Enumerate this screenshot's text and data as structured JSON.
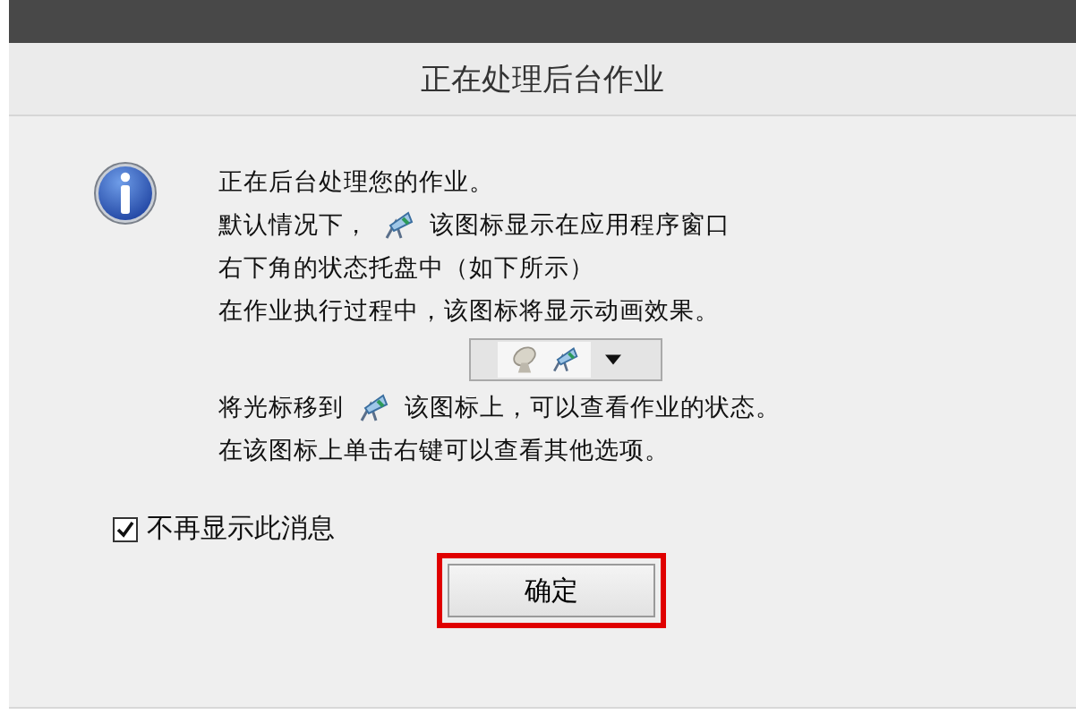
{
  "window": {
    "title": "正在处理后台作业"
  },
  "message": [
    {
      "kind": "text",
      "text": "正在后台处理您的作业。"
    },
    {
      "kind": "icon_text",
      "before": "默认情况下，",
      "after": "该图标显示在应用程序窗口"
    },
    {
      "kind": "text",
      "text": "右下角的状态托盘中（如下所示）"
    },
    {
      "kind": "text",
      "text": "在作业执行过程中，该图标将显示动画效果。"
    },
    {
      "kind": "tray"
    },
    {
      "kind": "icon_text",
      "before": "将光标移到",
      "after": "该图标上，可以查看作业的状态。"
    },
    {
      "kind": "text",
      "text": "在该图标上单击右键可以查看其他选项。"
    }
  ],
  "checkbox": {
    "label": "不再显示此消息",
    "checked": true
  },
  "button": {
    "label": "确定",
    "highlighted": true
  }
}
